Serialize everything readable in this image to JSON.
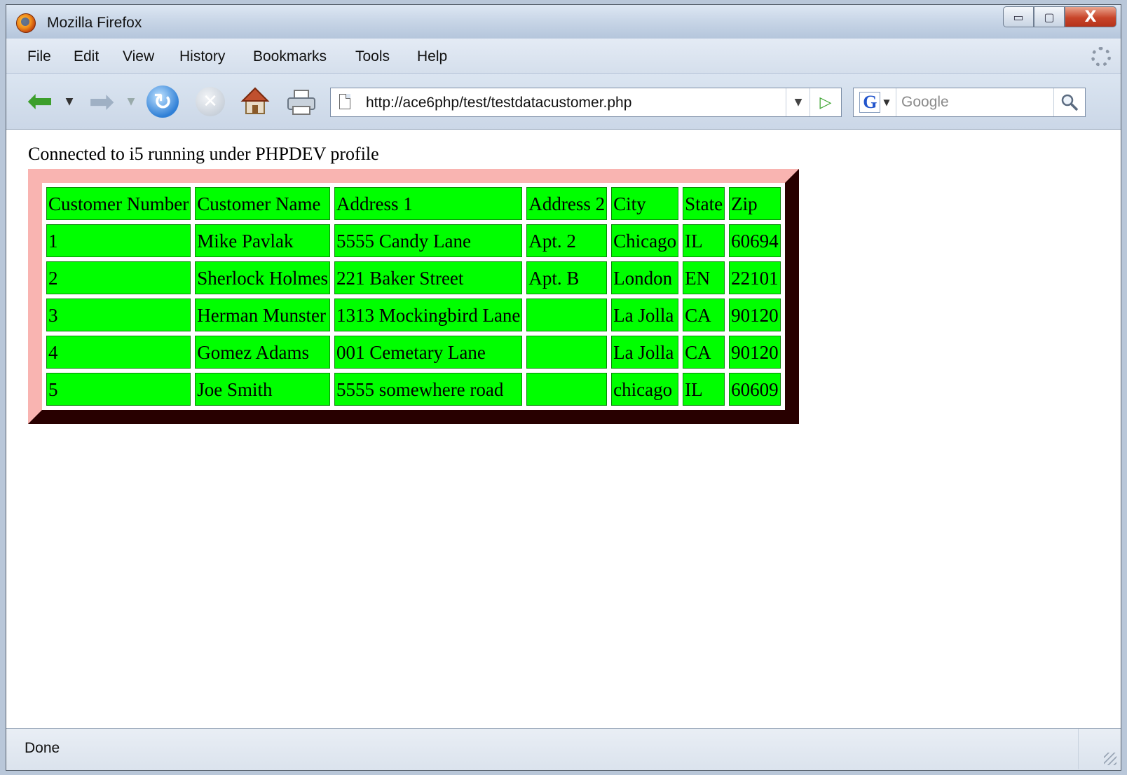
{
  "window": {
    "title": "Mozilla Firefox"
  },
  "window_controls": {
    "minimize": "▭",
    "maximize": "▢",
    "close": "X"
  },
  "menubar": {
    "items": [
      "File",
      "Edit",
      "View",
      "History",
      "Bookmarks",
      "Tools",
      "Help"
    ]
  },
  "navbar": {
    "url": "http://ace6php/test/testdatacustomer.php",
    "search_placeholder": "Google",
    "icons": [
      "back-arrow-icon",
      "forward-arrow-icon",
      "reload-icon",
      "stop-icon",
      "home-icon",
      "print-icon",
      "go-arrow-icon",
      "google-logo-icon",
      "magnifier-icon"
    ]
  },
  "page": {
    "status_message": "Connected to i5 running under PHPDEV profile",
    "table": {
      "headers": [
        "Customer Number",
        "Customer Name",
        "Address 1",
        "Address 2",
        "City",
        "State",
        "Zip"
      ],
      "rows": [
        [
          "1",
          "Mike Pavlak",
          "5555 Candy Lane",
          "Apt. 2",
          "Chicago",
          "IL",
          "60694"
        ],
        [
          "2",
          "Sherlock Holmes",
          "221 Baker Street",
          "Apt. B",
          "London",
          "EN",
          "22101"
        ],
        [
          "3",
          "Herman Munster",
          "1313 Mockingbird Lane",
          "",
          "La Jolla",
          "CA",
          "90120"
        ],
        [
          "4",
          "Gomez Adams",
          "001 Cemetary Lane",
          "",
          "La Jolla",
          "CA",
          "90120"
        ],
        [
          "5",
          "Joe Smith",
          "5555 somewhere road",
          "",
          "chicago",
          "IL",
          "60609"
        ]
      ]
    },
    "colors": {
      "cell_bg": "#00ff00",
      "border_light": "#f9b4b1",
      "border_dark": "#7c0000"
    }
  },
  "statusbar": {
    "text": "Done"
  }
}
